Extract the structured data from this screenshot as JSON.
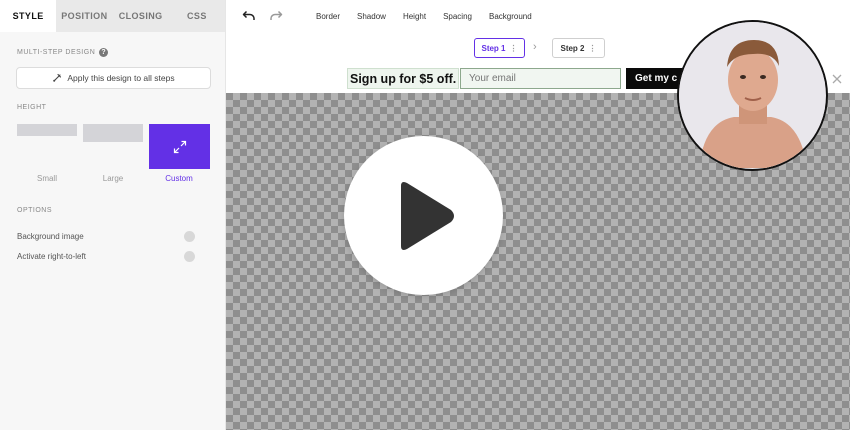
{
  "sidebar": {
    "tabs": [
      {
        "label": "STYLE"
      },
      {
        "label": "POSITION"
      },
      {
        "label": "CLOSING"
      },
      {
        "label": "CSS"
      }
    ],
    "multistep_label": "MULTI-STEP DESIGN",
    "apply_button": "Apply this design to all steps",
    "height_label": "HEIGHT",
    "height_options": [
      "Small",
      "Large",
      "Custom"
    ],
    "height_selected": "Custom",
    "options_label": "OPTIONS",
    "options": [
      {
        "label": "Background image"
      },
      {
        "label": "Activate right-to-left"
      }
    ]
  },
  "toolbar": {
    "items": [
      "Border",
      "Shadow",
      "Height",
      "Spacing",
      "Background"
    ]
  },
  "steps": [
    {
      "label": "Step 1"
    },
    {
      "label": "Step 2"
    }
  ],
  "popup": {
    "headline": "Sign up for $5 off.",
    "email_placeholder": "Your email",
    "button_label": "Get my c"
  },
  "colors": {
    "accent": "#6330e6",
    "canvas_checker_dark": "#8e8e8e",
    "canvas_checker_light": "#b3b3b3",
    "popup_button": "#0a0a0a"
  },
  "icons": {
    "undo": "undo-icon",
    "redo": "redo-icon",
    "play": "play-icon",
    "close": "close-icon",
    "expand": "expand-arrows-icon",
    "help": "help-icon",
    "brush": "brush-icon"
  }
}
